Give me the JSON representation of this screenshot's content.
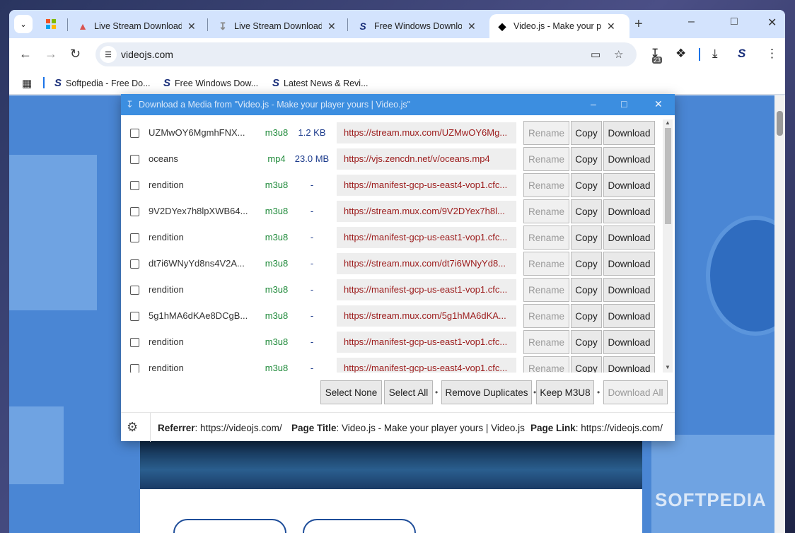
{
  "tabs": [
    {
      "label": "Live Stream Downloade",
      "icon": "live-stream-icon",
      "active": false
    },
    {
      "label": "Live Stream Downloade",
      "icon": "download-icon",
      "active": false
    },
    {
      "label": "Free Windows Downloa",
      "icon": "softpedia-icon",
      "active": false
    },
    {
      "label": "Video.js - Make your pla",
      "icon": "videojs-icon",
      "active": true
    }
  ],
  "url": "videojs.com",
  "extension_badge": "23",
  "bookmarks": [
    {
      "label": "Softpedia - Free Do..."
    },
    {
      "label": "Free Windows Dow..."
    },
    {
      "label": "Latest News & Revi..."
    }
  ],
  "dialog": {
    "title": "Download a Media from \"Video.js - Make your player yours | Video.js\"",
    "rows": [
      {
        "name": "UZMwOY6MgmhFNX...",
        "type": "m3u8",
        "size": "1.2 KB",
        "url": "https://stream.mux.com/UZMwOY6Mg..."
      },
      {
        "name": "oceans",
        "type": "mp4",
        "size": "23.0 MB",
        "url": "https://vjs.zencdn.net/v/oceans.mp4"
      },
      {
        "name": "rendition",
        "type": "m3u8",
        "size": "-",
        "url": "https://manifest-gcp-us-east4-vop1.cfc..."
      },
      {
        "name": "9V2DYex7h8lpXWB64...",
        "type": "m3u8",
        "size": "-",
        "url": "https://stream.mux.com/9V2DYex7h8l..."
      },
      {
        "name": "rendition",
        "type": "m3u8",
        "size": "-",
        "url": "https://manifest-gcp-us-east1-vop1.cfc..."
      },
      {
        "name": "dt7i6WNyYd8ns4V2A...",
        "type": "m3u8",
        "size": "-",
        "url": "https://stream.mux.com/dt7i6WNyYd8..."
      },
      {
        "name": "rendition",
        "type": "m3u8",
        "size": "-",
        "url": "https://manifest-gcp-us-east1-vop1.cfc..."
      },
      {
        "name": "5g1hMA6dKAe8DCgB...",
        "type": "m3u8",
        "size": "-",
        "url": "https://stream.mux.com/5g1hMA6dKA..."
      },
      {
        "name": "rendition",
        "type": "m3u8",
        "size": "-",
        "url": "https://manifest-gcp-us-east1-vop1.cfc..."
      },
      {
        "name": "rendition",
        "type": "m3u8",
        "size": "-",
        "url": "https://manifest-gcp-us-east4-vop1.cfc..."
      }
    ],
    "row_buttons": {
      "rename": "Rename",
      "copy": "Copy",
      "download": "Download"
    },
    "actions": {
      "select_none": "Select None",
      "select_all": "Select All",
      "remove_duplicates": "Remove Duplicates",
      "keep_m3u8": "Keep M3U8",
      "download_all": "Download All",
      "separator": "•"
    },
    "footer": {
      "referrer_label": "Referrer",
      "referrer_value": ": https://videojs.com/",
      "page_title_label": "Page Title",
      "page_title_value": ": Video.js - Make your player yours | Video.js",
      "page_link_label": "Page Link",
      "page_link_value": ": https://videojs.com/"
    }
  },
  "watermark": "SOFTPEDIA",
  "colors": {
    "dialog_title_bar": "#3c8ee0",
    "url_text": "#9c1c1c",
    "type_text": "#1f8a3a",
    "size_text": "#1c3b8c",
    "page_background": "#4a86d4"
  }
}
